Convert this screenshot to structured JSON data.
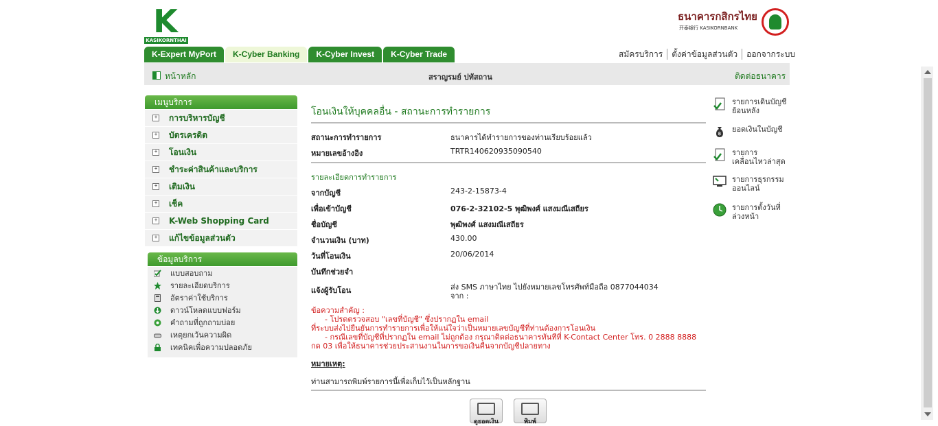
{
  "header": {
    "logo_text": "KASIKORNTHAI",
    "bank_name_th": "ธนาคารกสิกรไทย",
    "bank_name_en": "开泰银行 KASIKORNBANK"
  },
  "tabs": [
    {
      "label": "K-Expert MyPort"
    },
    {
      "label": "K-Cyber Banking"
    },
    {
      "label": "K-Cyber Invest"
    },
    {
      "label": "K-Cyber Trade"
    }
  ],
  "top_links": [
    "สมัครบริการ",
    "ตั้งค่าข้อมูลส่วนตัว",
    "ออกจากระบบ"
  ],
  "bar": {
    "home": "หน้าหลัก",
    "user_name": "สราญรมย์ ปทัสถาน",
    "contact": "ติดต่อธนาคาร"
  },
  "menu": {
    "title": "เมนูบริการ",
    "items": [
      {
        "label": "การบริหารบัญชี"
      },
      {
        "label": "บัตรเครดิต"
      },
      {
        "label": "โอนเงิน"
      },
      {
        "label": "ชำระค่าสินค้าและบริการ"
      },
      {
        "label": "เติมเงิน"
      },
      {
        "label": "เช็ค"
      },
      {
        "label": "K-Web Shopping Card"
      },
      {
        "label": "แก้ไขข้อมูลส่วนตัว"
      }
    ]
  },
  "info": {
    "title": "ข้อมูลบริการ",
    "items": [
      {
        "label": "แบบสอบถาม"
      },
      {
        "label": "รายละเอียดบริการ"
      },
      {
        "label": "อัตราค่าใช้บริการ"
      },
      {
        "label": "ดาวน์โหลดแบบฟอร์ม"
      },
      {
        "label": "คำถามที่ถูกถามบ่อย"
      },
      {
        "label": "เหตุยกเว้นความผิด"
      },
      {
        "label": "เทคนิคเพื่อความปลอดภัย"
      }
    ]
  },
  "main": {
    "title": "โอนเงินให้บุคคลอื่น - สถานะการทำรายการ",
    "status_label": "สถานะการทำรายการ",
    "status_value": "ธนาคารได้ทำรายการของท่านเรียบร้อยแล้ว",
    "ref_label": "หมายเลขอ้างอิง",
    "ref_value": "TRTR140620935090540",
    "section_title": "รายละเอียดการทำรายการ",
    "from_label": "จากบัญชี",
    "from_value": "243-2-15873-4",
    "to_label": "เพื่อเข้าบัญชี",
    "to_value": "076-2-32102-5 พุฒิพงศ์ แสงมณีเสถียร",
    "name_label": "ชื่อบัญชี",
    "name_value": "พุฒิพงศ์ แสงมณีเสถียร",
    "amount_label": "จำนวนเงิน (บาท)",
    "amount_value": "430.00",
    "date_label": "วันที่โอนเงิน",
    "date_value": "20/06/2014",
    "memo_label": "บันทึกช่วยจำ",
    "notify_label": "แจ้งผู้รับโอน",
    "notify_value_1": "ส่ง SMS ภาษาไทย ไปยังหมายเลขโทรศัพท์มือถือ 0877044034",
    "notify_value_2": "จาก :",
    "warn_1": "ข้อความสำคัญ :",
    "warn_2": "- โปรดตรวจสอบ \"เลขที่บัญชี\" ซึ่งปรากฏใน email",
    "warn_3": "ที่ระบบส่งไปยืนยันการทำรายการเพื่อให้แน่ใจว่าเป็นหมายเลขบัญชีที่ท่านต้องการโอนเงิน",
    "warn_4": "- กรณีเลขที่บัญชีที่ปรากฏใน email ไม่ถูกต้อง กรุณาติดต่อธนาคารทันทีที่ K-Contact Center โทร. 0 2888 8888",
    "warn_5": "กด 03 เพื่อให้ธนาคารช่วยประสานงานในการขอเงินคืนจากบัญชีปลายทาง",
    "note_title": "หมายเหตุ:",
    "note_text": "ท่านสามารถพิมพ์รายการนี้เพื่อเก็บไว้เป็นหลักฐาน",
    "btn_balance": "ดูยอดเงิน",
    "btn_print": "พิมพ์"
  },
  "right": {
    "items": [
      {
        "label": "รายการเดินบัญชีย้อนหลัง"
      },
      {
        "label": "ยอดเงินในบัญชี"
      },
      {
        "label": "รายการเคลื่อนไหวล่าสุด"
      },
      {
        "label": "รายการธุรกรรมออนไลน์"
      },
      {
        "label": "รายการตั้งวันที่ล่วงหน้า"
      }
    ]
  },
  "colors": {
    "brand_green": "#1f7a1f",
    "tab_green": "#2f8d2f",
    "warn_red": "#d21e1e"
  }
}
